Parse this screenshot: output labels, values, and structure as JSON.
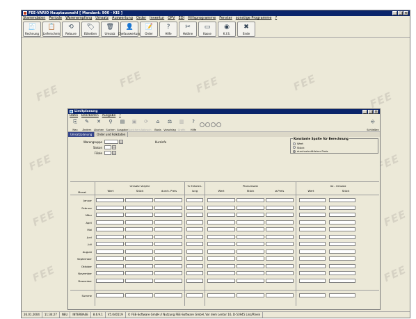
{
  "app": {
    "title": "FEE-VARIO Hauptauswahl [ Mandant: 900 - KIS ]",
    "window_buttons": [
      "_",
      "□",
      "×"
    ]
  },
  "menubar": [
    "Stammdaten",
    "Periode",
    "Warenempfang",
    "Umsatz",
    "Auswertung",
    "Order",
    "Inventur",
    "OPV",
    "EDI",
    "Hilfsprogramme",
    "Fenster",
    "sonstige Programme",
    "?"
  ],
  "toolbar": [
    {
      "label": "Rechnung",
      "icon": "invoice-icon",
      "glyph": "🧾"
    },
    {
      "label": "Lieferschein",
      "icon": "delivery-note-icon",
      "glyph": "📋"
    },
    {
      "label": "Retoure",
      "icon": "return-icon",
      "glyph": "⟲"
    },
    {
      "label": "Etiketten",
      "icon": "label-icon",
      "glyph": "🏷"
    },
    {
      "label": "Umsatz",
      "icon": "sales-icon",
      "glyph": "🗑"
    },
    {
      "label": "Chefauswertung",
      "icon": "report-icon",
      "glyph": "👤"
    },
    {
      "label": "Order",
      "icon": "order-icon",
      "glyph": "📝"
    },
    {
      "label": "Hilfe",
      "icon": "help-icon",
      "glyph": "?"
    },
    {
      "label": "Hotline",
      "icon": "hotline-icon",
      "glyph": "✂"
    },
    {
      "label": "Kasse",
      "icon": "cash-register-icon",
      "glyph": "▭"
    },
    {
      "label": "K.I.S.",
      "icon": "kis-icon",
      "glyph": "◉"
    },
    {
      "label": "Ende",
      "icon": "exit-icon",
      "glyph": "✖"
    }
  ],
  "watermark": "FEE",
  "statusbar": [
    "26.01.2004",
    "11:34:27",
    "NEU",
    "INTERBASE",
    "8.6.9.1",
    "V5.040119",
    "© FEE-Software GmbH // Nutzung FEE-Software GmbH, Vor dem Lentor 16, D-53945 Linz/Rhein"
  ],
  "child": {
    "title": "Limitplanung",
    "menu": [
      "Datei",
      "Bearbeiten",
      "Ausgabe",
      "?"
    ],
    "toolbar": [
      {
        "label": "Neu",
        "icon": "new-icon",
        "glyph": "⎘",
        "enabled": true
      },
      {
        "label": "Ändern",
        "icon": "edit-icon",
        "glyph": "✎",
        "enabled": true
      },
      {
        "label": "Löschen",
        "icon": "delete-icon",
        "glyph": "✕",
        "enabled": true
      },
      {
        "label": "Suchen",
        "icon": "search-icon",
        "glyph": "⚲",
        "enabled": true
      },
      {
        "label": "Ausgabe",
        "icon": "output-icon",
        "glyph": "▤",
        "enabled": true
      },
      {
        "label": "Speichern",
        "icon": "save-icon",
        "glyph": "▣",
        "enabled": false
      },
      {
        "label": "Abbruch",
        "icon": "cancel-icon",
        "glyph": "⟳",
        "enabled": false
      },
      {
        "label": "Basis",
        "icon": "basis-icon",
        "glyph": "⌂",
        "enabled": true
      },
      {
        "label": "Vorschlag",
        "icon": "suggestion-icon",
        "glyph": "⚖",
        "enabled": true
      },
      {
        "label": "Grafik",
        "icon": "chart-icon",
        "glyph": "▥",
        "enabled": false
      },
      {
        "label": "Hilfe",
        "icon": "help-icon",
        "glyph": "?",
        "enabled": true
      }
    ],
    "close_label": "Schließen",
    "tabs": [
      "Umsatzplanung",
      "Order und Folkdaten"
    ],
    "fields": {
      "warengruppe": "Warengruppe",
      "saison": "Saison",
      "filiale": "Filiale",
      "kurzinfo": "Kurzinfo"
    },
    "constant_group": {
      "title": "Konstante Spalte für Berechnung",
      "options": [
        "Wert",
        "Stück",
        "durchschnittlicher Preis"
      ],
      "selected": 2
    },
    "grid": {
      "headers": {
        "monat": "Monat",
        "vorjahr": "Umsatz Vorjahr",
        "vj_wert": "Wert",
        "vj_stueck": "Stück",
        "vj_preis": "durch. Preis",
        "entwicklung": "% Entwick-",
        "entwicklung2": "lung",
        "plan": "Planumsatz",
        "plan_wert": "Wert",
        "plan_stueck": "Stück",
        "plan_preis": "ø-Preis",
        "ist": "Ist - Umsatz",
        "ist_wert": "Wert",
        "ist_stueck": "Stück"
      },
      "months": [
        "Januar",
        "Februar",
        "März",
        "April",
        "Mai",
        "Juni",
        "Juli",
        "August",
        "September",
        "Oktober",
        "November",
        "Dezember"
      ],
      "sum_label": "Summe"
    }
  }
}
